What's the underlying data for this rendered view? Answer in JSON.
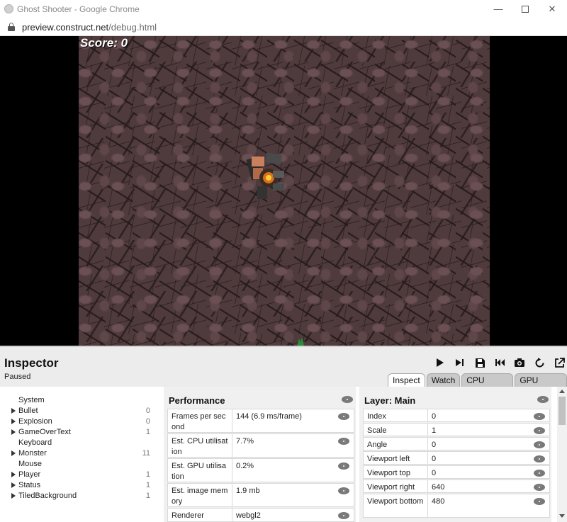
{
  "window": {
    "title": "Ghost Shooter - Google Chrome",
    "url_host": "preview.construct.net",
    "url_path": "/debug.html"
  },
  "game": {
    "score_text": "Score: 0"
  },
  "inspector": {
    "title": "Inspector",
    "status": "Paused",
    "tabs": [
      "Inspect",
      "Watch",
      "CPU profiler",
      "GPU profiler"
    ],
    "active_tab": "Inspect",
    "toolbar": [
      "play-icon",
      "step-icon",
      "save-icon",
      "restart-icon",
      "screenshot-icon",
      "reload-icon",
      "popout-icon"
    ],
    "objects": [
      {
        "name": "System",
        "count": "",
        "expandable": false
      },
      {
        "name": "Bullet",
        "count": "0",
        "expandable": true
      },
      {
        "name": "Explosion",
        "count": "0",
        "expandable": true
      },
      {
        "name": "GameOverText",
        "count": "1",
        "expandable": true
      },
      {
        "name": "Keyboard",
        "count": "",
        "expandable": false
      },
      {
        "name": "Monster",
        "count": "11",
        "expandable": true
      },
      {
        "name": "Mouse",
        "count": "",
        "expandable": false
      },
      {
        "name": "Player",
        "count": "1",
        "expandable": true
      },
      {
        "name": "Status",
        "count": "1",
        "expandable": true
      },
      {
        "name": "TiledBackground",
        "count": "1",
        "expandable": true
      }
    ],
    "performance": {
      "title": "Performance",
      "rows": [
        {
          "key": "Frames per second",
          "value": "144 (6.9 ms/frame)"
        },
        {
          "key": "Est. CPU utilisation",
          "value": "7.7%"
        },
        {
          "key": "Est. GPU utilisation",
          "value": "0.2%"
        },
        {
          "key": "Est. image memory",
          "value": "1.9 mb"
        },
        {
          "key": "Renderer",
          "value": "webgl2"
        }
      ]
    },
    "layer": {
      "title": "Layer: Main",
      "rows": [
        {
          "key": "Index",
          "value": "0"
        },
        {
          "key": "Scale",
          "value": "1"
        },
        {
          "key": "Angle",
          "value": "0"
        },
        {
          "key": "Viewport left",
          "value": "0"
        },
        {
          "key": "Viewport top",
          "value": "0"
        },
        {
          "key": "Viewport right",
          "value": "640"
        },
        {
          "key": "Viewport bottom",
          "value": "480"
        }
      ]
    }
  }
}
